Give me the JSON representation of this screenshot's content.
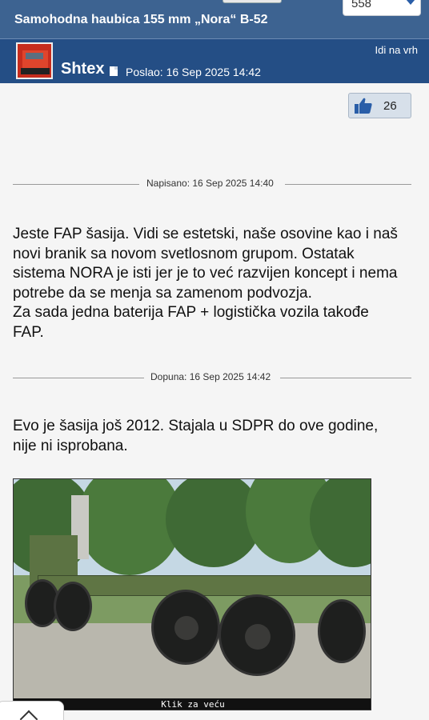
{
  "header": {
    "page_select_value": "558",
    "thread_title": "Samohodna haubica 155 mm „Nora“ B-52",
    "to_top_link": "Idi na vrh"
  },
  "post": {
    "author": "Shtex",
    "posted_label": "Poslao: 16 Sep 2025 14:42",
    "like_count": "26",
    "written_separator": "Napisano: 16 Sep 2025 14:40",
    "paragraph_1_lines": [
      "Jeste FAP šasija. Vidi se estetski, naše osovine kao i naš",
      "novi branik sa novom svetlosnom grupom. Ostatak",
      "sistema NORA je isti jer je to već razvijen koncept i nema",
      "potrebe da se menja sa zamenom podvozja.",
      "Za sada jedna baterija FAP + logistička vozila takođe",
      "FAP."
    ],
    "addition_separator": "Dopuna: 16 Sep 2025 14:42",
    "paragraph_2_lines": [
      "Evo je šasija još 2012. Stajala u SDPR do ove godine,",
      "nije ni isprobana."
    ],
    "image_caption": "Klik za veću"
  },
  "icons": {
    "like": "thumbs-up-icon",
    "post": "post-document-icon",
    "dropdown": "chevron-down-icon",
    "collapse": "chevron-up-icon"
  },
  "colors": {
    "header_bg": "#3d6391",
    "userbar_bg": "#244e85",
    "like_bg": "#d7e0ea",
    "thumb": "#2a5ea8"
  }
}
